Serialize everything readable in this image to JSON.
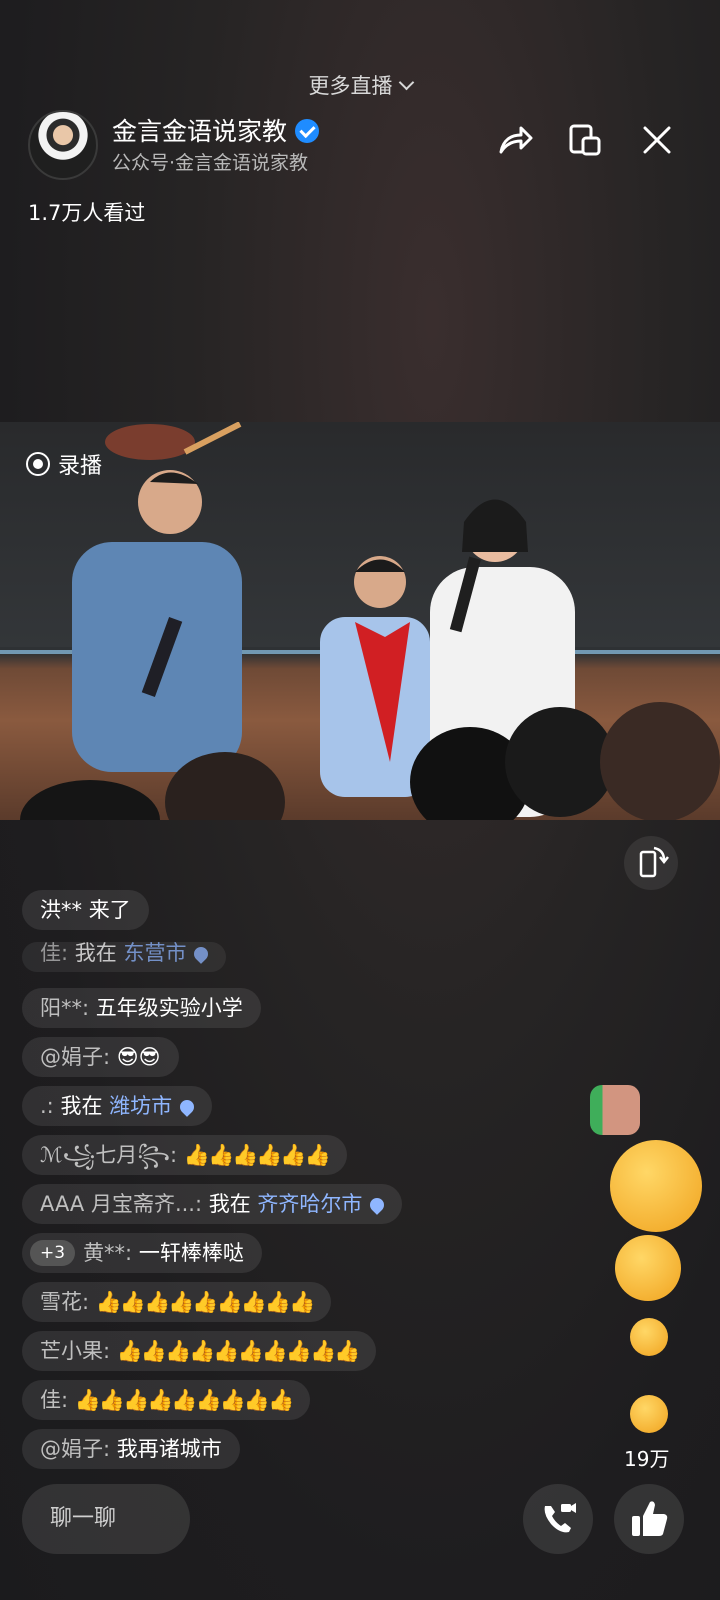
{
  "top": {
    "more_live": "更多直播"
  },
  "host": {
    "name": "金言金语说家教",
    "subtitle": "公众号·金言金语说家教"
  },
  "viewers": "1.7万人看过",
  "video": {
    "status": "录播"
  },
  "chat": {
    "messages": [
      {
        "user": "洪**",
        "text": "来了"
      },
      {
        "user": "佳:",
        "text": "我在",
        "location": "东营市"
      },
      {
        "user": "阳**:",
        "text": "五年级实验小学"
      },
      {
        "user": "@娟子:",
        "text": "😎😎"
      },
      {
        "user": ".:",
        "text": "我在",
        "location": "潍坊市"
      },
      {
        "user": "ℳ꧁七月꧂:",
        "text": "👍👍👍👍👍👍"
      },
      {
        "user": "AAA 月宝斋齐...:",
        "text": "我在",
        "location": "齐齐哈尔市"
      },
      {
        "badge": "+3",
        "user": "黄**:",
        "text": "一轩棒棒哒"
      },
      {
        "user": "雪花:",
        "text": "👍👍👍👍👍👍👍👍👍"
      },
      {
        "user": "芒小果:",
        "text": "👍👍👍👍👍👍👍👍👍👍"
      },
      {
        "user": "佳:",
        "text": "👍👍👍👍👍👍👍👍👍"
      },
      {
        "user": "@娟子:",
        "text": "我再诸城市"
      }
    ]
  },
  "likes_count": "19万",
  "input_placeholder": "聊一聊",
  "icons": {
    "share": "share-icon",
    "pip": "picture-in-picture-icon",
    "close": "close-icon",
    "rotate": "rotate-screen-icon",
    "call": "video-call-icon",
    "like": "thumbs-up-icon"
  }
}
